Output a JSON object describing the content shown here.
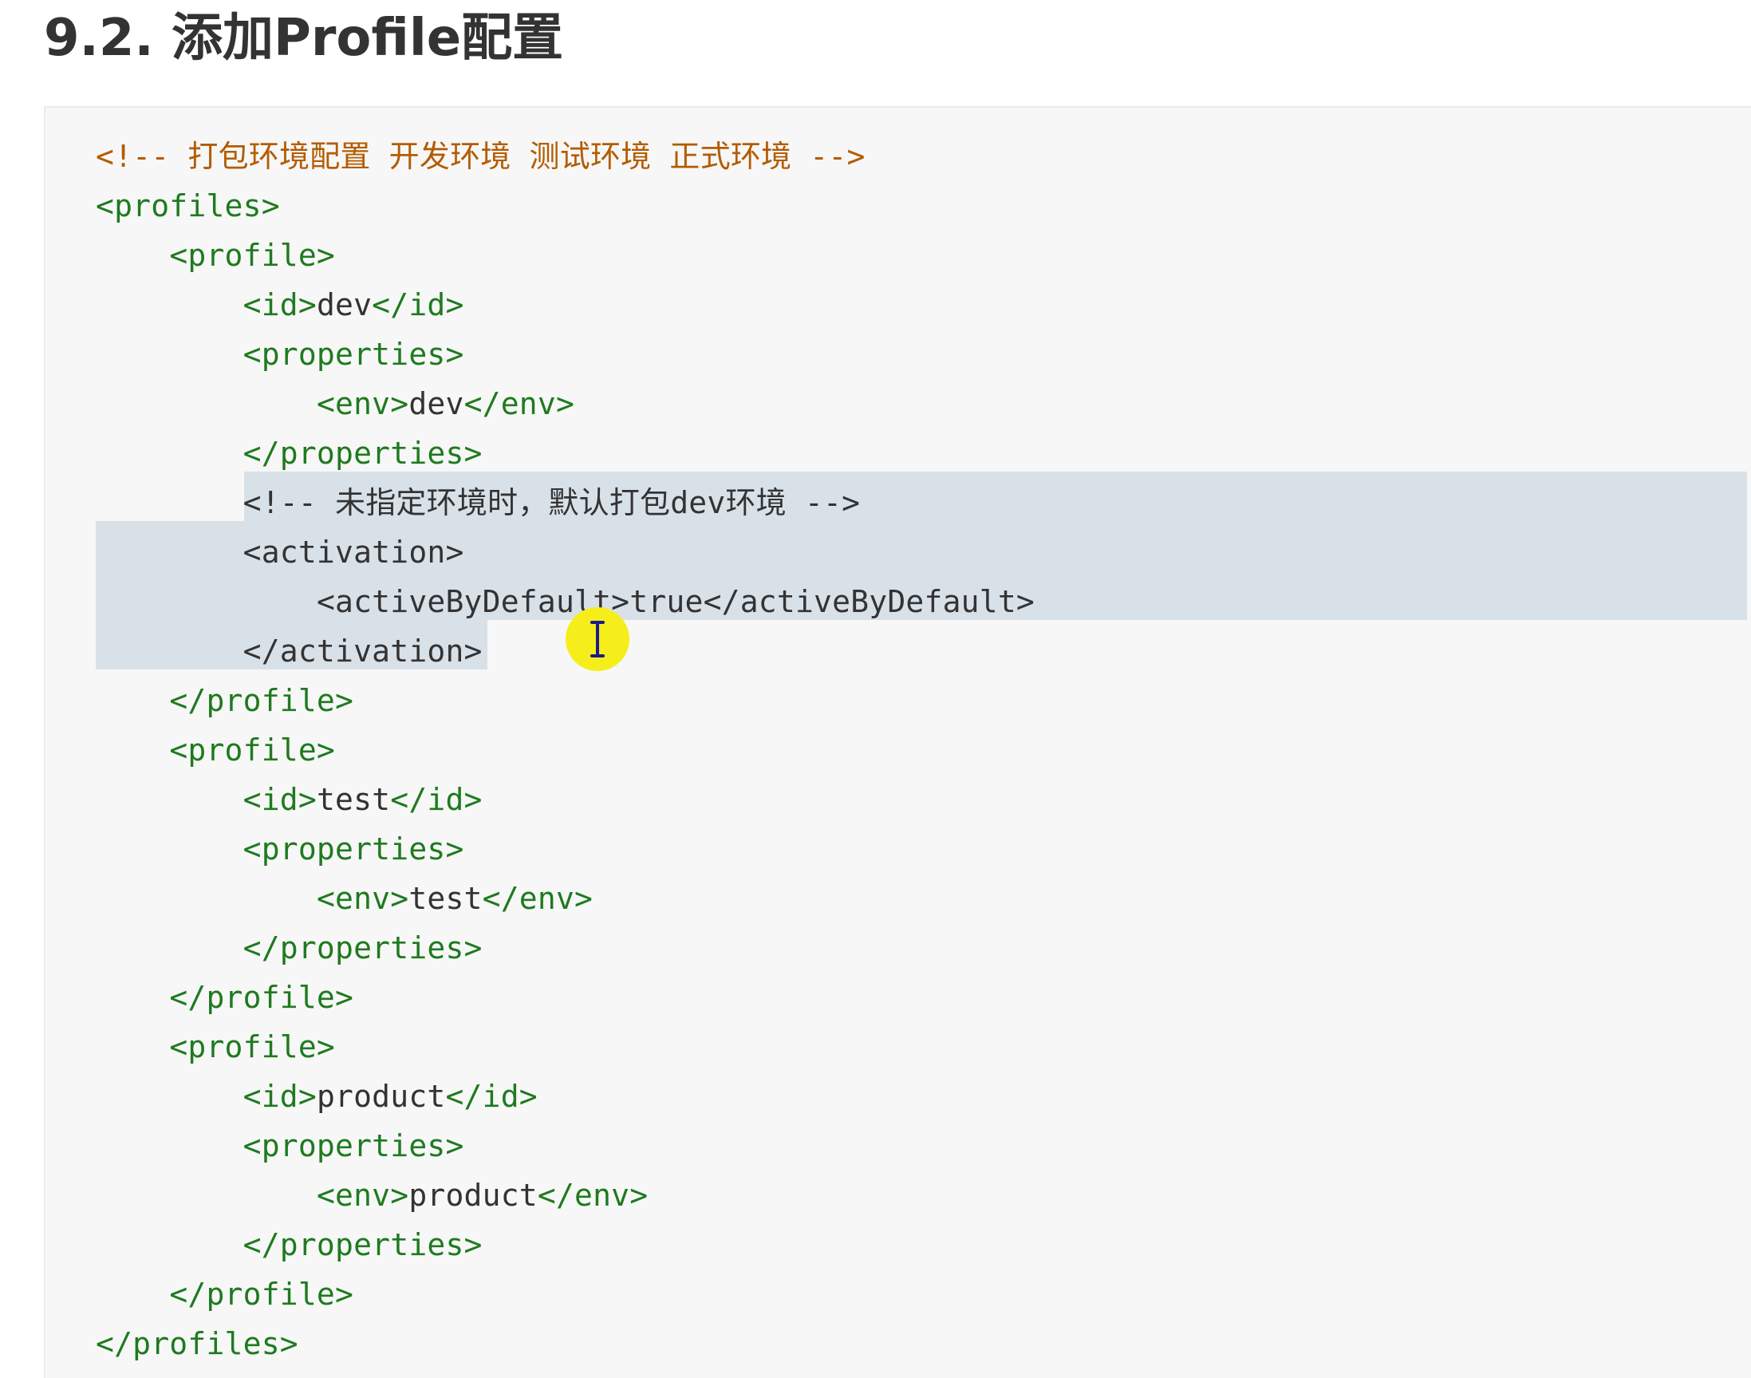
{
  "heading": "9.2. 添加Profile配置",
  "code": {
    "language": "xml",
    "lines": [
      [
        {
          "cls": "comment",
          "t": "<!-- 打包环境配置 开发环境 测试环境 正式环境 -->"
        }
      ],
      [
        {
          "cls": "tag",
          "t": "<profiles>"
        }
      ],
      [
        {
          "cls": "text",
          "t": "    "
        },
        {
          "cls": "tag",
          "t": "<profile>"
        }
      ],
      [
        {
          "cls": "text",
          "t": "        "
        },
        {
          "cls": "tag",
          "t": "<id>"
        },
        {
          "cls": "text",
          "t": "dev"
        },
        {
          "cls": "tag",
          "t": "</id>"
        }
      ],
      [
        {
          "cls": "text",
          "t": "        "
        },
        {
          "cls": "tag",
          "t": "<properties>"
        }
      ],
      [
        {
          "cls": "text",
          "t": "            "
        },
        {
          "cls": "tag",
          "t": "<env>"
        },
        {
          "cls": "text",
          "t": "dev"
        },
        {
          "cls": "tag",
          "t": "</env>"
        }
      ],
      [
        {
          "cls": "text",
          "t": "        "
        },
        {
          "cls": "tag",
          "t": "</properties>"
        }
      ],
      [
        {
          "cls": "text",
          "t": "        "
        },
        {
          "cls": "text",
          "t": "<!-- 未指定环境时，默认打包dev环境 -->"
        }
      ],
      [
        {
          "cls": "text",
          "t": "        "
        },
        {
          "cls": "text",
          "t": "<activation>"
        }
      ],
      [
        {
          "cls": "text",
          "t": "            "
        },
        {
          "cls": "text",
          "t": "<activeByDefault>true</activeByDefault>"
        }
      ],
      [
        {
          "cls": "text",
          "t": "        "
        },
        {
          "cls": "text",
          "t": "</activation>"
        }
      ],
      [
        {
          "cls": "text",
          "t": "    "
        },
        {
          "cls": "tag",
          "t": "</profile>"
        }
      ],
      [
        {
          "cls": "text",
          "t": "    "
        },
        {
          "cls": "tag",
          "t": "<profile>"
        }
      ],
      [
        {
          "cls": "text",
          "t": "        "
        },
        {
          "cls": "tag",
          "t": "<id>"
        },
        {
          "cls": "text",
          "t": "test"
        },
        {
          "cls": "tag",
          "t": "</id>"
        }
      ],
      [
        {
          "cls": "text",
          "t": "        "
        },
        {
          "cls": "tag",
          "t": "<properties>"
        }
      ],
      [
        {
          "cls": "text",
          "t": "            "
        },
        {
          "cls": "tag",
          "t": "<env>"
        },
        {
          "cls": "text",
          "t": "test"
        },
        {
          "cls": "tag",
          "t": "</env>"
        }
      ],
      [
        {
          "cls": "text",
          "t": "        "
        },
        {
          "cls": "tag",
          "t": "</properties>"
        }
      ],
      [
        {
          "cls": "text",
          "t": "    "
        },
        {
          "cls": "tag",
          "t": "</profile>"
        }
      ],
      [
        {
          "cls": "text",
          "t": "    "
        },
        {
          "cls": "tag",
          "t": "<profile>"
        }
      ],
      [
        {
          "cls": "text",
          "t": "        "
        },
        {
          "cls": "tag",
          "t": "<id>"
        },
        {
          "cls": "text",
          "t": "product"
        },
        {
          "cls": "tag",
          "t": "</id>"
        }
      ],
      [
        {
          "cls": "text",
          "t": "        "
        },
        {
          "cls": "tag",
          "t": "<properties>"
        }
      ],
      [
        {
          "cls": "text",
          "t": "            "
        },
        {
          "cls": "tag",
          "t": "<env>"
        },
        {
          "cls": "text",
          "t": "product"
        },
        {
          "cls": "tag",
          "t": "</env>"
        }
      ],
      [
        {
          "cls": "text",
          "t": "        "
        },
        {
          "cls": "tag",
          "t": "</properties>"
        }
      ],
      [
        {
          "cls": "text",
          "t": "    "
        },
        {
          "cls": "tag",
          "t": "</profile>"
        }
      ],
      [
        {
          "cls": "tag",
          "t": "</profiles>"
        }
      ]
    ],
    "selected_lines": [
      7,
      8,
      9,
      10
    ]
  },
  "cursor": {
    "type": "text-cursor-icon",
    "highlight_color": "#f6ee1a"
  }
}
